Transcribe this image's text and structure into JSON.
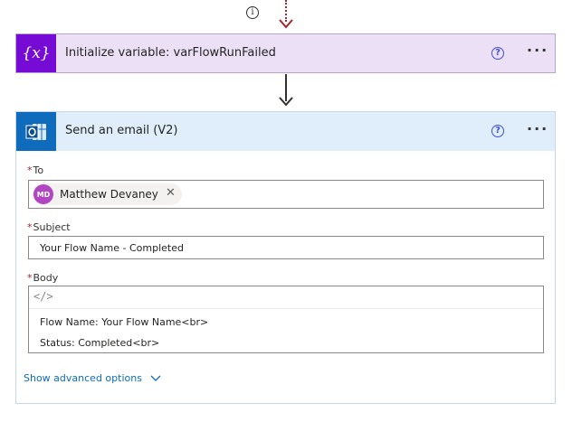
{
  "connector": {
    "info_symbol": "i"
  },
  "init_variable": {
    "icon_text": "{x}",
    "title": "Initialize variable: varFlowRunFailed",
    "help_symbol": "?",
    "more_symbol": "···",
    "icon_bg": "#770bd6",
    "header_bg": "#ece0f6"
  },
  "send_email": {
    "title": "Send an email (V2)",
    "help_symbol": "?",
    "more_symbol": "···",
    "icon_bg": "#0f6cbd",
    "header_bg": "#dfeefa",
    "required_marker": "*",
    "to": {
      "label": "To",
      "recipient": {
        "initials": "MD",
        "name": "Matthew Devaney",
        "remove_symbol": "✕"
      }
    },
    "subject": {
      "label": "Subject",
      "value": "Your Flow Name -  Completed"
    },
    "body": {
      "label": "Body",
      "code_toggle": "</>",
      "lines": [
        "Flow Name: Your Flow Name<br>",
        "Status: Completed<br>"
      ]
    },
    "advanced_options": "Show advanced options"
  }
}
